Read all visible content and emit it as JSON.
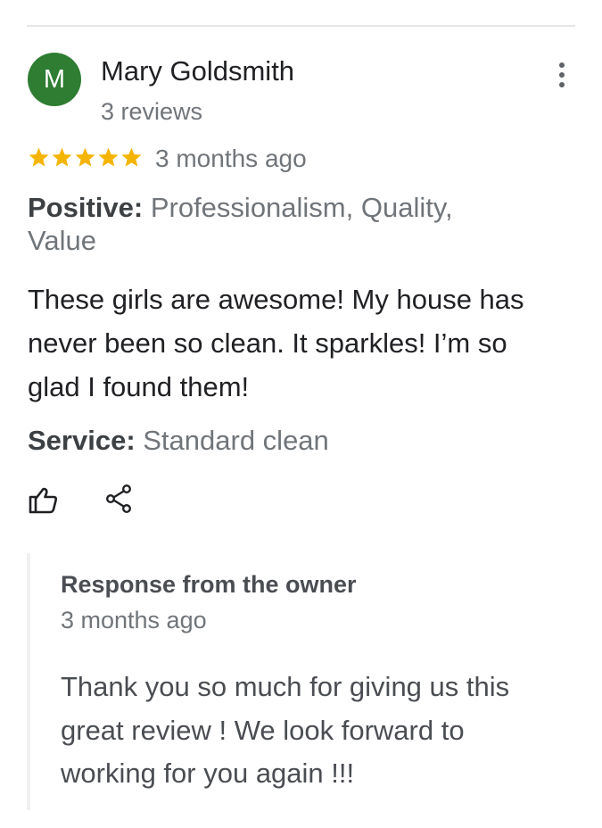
{
  "reviewer": {
    "initial": "M",
    "name": "Mary Goldsmith",
    "review_count": "3 reviews",
    "avatar_color": "#2e7d32"
  },
  "review": {
    "rating": 5,
    "max_rating": 5,
    "star_color": "#f5b400",
    "date": "3 months ago",
    "positive_label": "Positive:",
    "positive_value": " Professionalism, Quality, Value",
    "text": "These girls are awesome! My house has never been so clean. It sparkles! I’m so glad I found them!",
    "service_label": "Service:",
    "service_value": " Standard clean"
  },
  "actions": {
    "like_icon": "thumbs-up-icon",
    "share_icon": "share-icon",
    "more_icon": "more-vert-icon"
  },
  "owner_response": {
    "title": "Response from the owner",
    "date": "3 months ago",
    "text": "Thank you so much for giving us this great review ! We look forward to working for you again !!!"
  }
}
